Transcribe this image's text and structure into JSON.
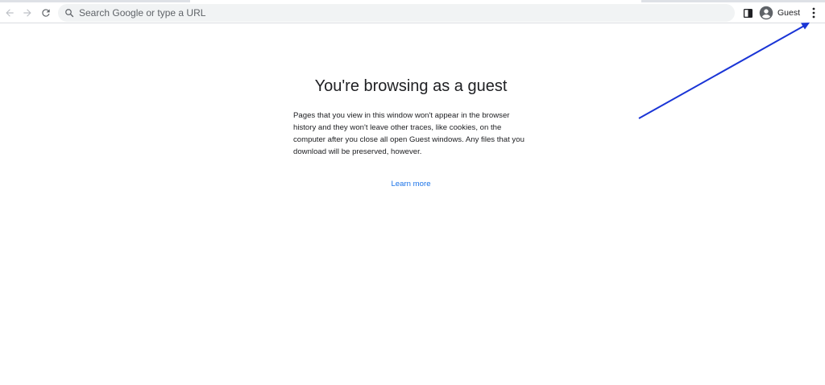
{
  "toolbar": {
    "search_placeholder": "Search Google or type a URL",
    "profile_label": "Guest",
    "icons": {
      "back": "arrow-left-icon",
      "forward": "arrow-right-icon",
      "reload": "reload-icon",
      "search": "search-icon",
      "side_panel": "side-panel-icon",
      "avatar": "account-circle-icon",
      "menu": "three-dots-vertical-icon"
    }
  },
  "page": {
    "title": "You're browsing as a guest",
    "description": "Pages that you view in this window won't appear in the browser history and they won't leave other traces, like cookies, on the computer after you close all open Guest windows. Any files that you download will be preserved, however.",
    "learn_more": "Learn more"
  },
  "annotation": {
    "type": "arrow",
    "color": "#1a35d6",
    "points_to": "menu-button"
  },
  "colors": {
    "link": "#1a73e8",
    "omnibox_bg": "#f1f3f4",
    "icon": "#5f6368"
  }
}
